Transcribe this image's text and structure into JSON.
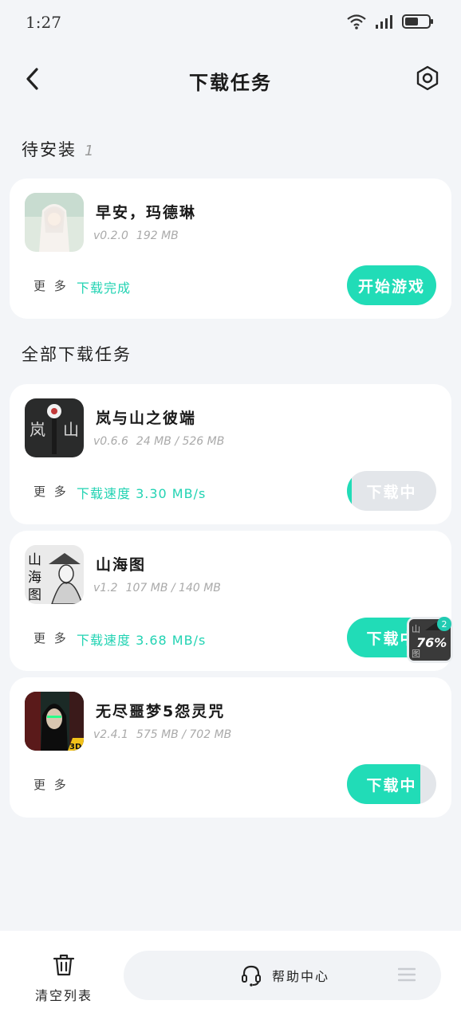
{
  "status_bar": {
    "time": "1:27"
  },
  "header": {
    "title": "下载任务"
  },
  "pending_section": {
    "title": "待安装",
    "count": "1"
  },
  "all_section": {
    "title": "全部下载任务"
  },
  "pending_items": [
    {
      "name": "早安，玛德琳",
      "version": "v0.2.0",
      "size": "192 MB",
      "more": "更 多",
      "status": "下载完成",
      "action": "开始游戏"
    }
  ],
  "download_items": [
    {
      "name": "岚与山之彼端",
      "version": "v0.6.6",
      "size": "24 MB / 526 MB",
      "more": "更 多",
      "status": "下载速度 3.30 MB/s",
      "action": "下载中",
      "progress": 0.05
    },
    {
      "name": "山海图",
      "version": "v1.2",
      "size": "107 MB / 140 MB",
      "more": "更 多",
      "status": "下载速度 3.68 MB/s",
      "action": "下载中",
      "progress": 0.76
    },
    {
      "name": "无尽噩梦5怨灵咒",
      "version": "v2.4.1",
      "size": "575 MB / 702 MB",
      "more": "更 多",
      "status": "",
      "action": "下载中",
      "progress": 0.82
    }
  ],
  "float_widget": {
    "badge": "2",
    "percent": "76%"
  },
  "bottom_bar": {
    "clear_label": "清空列表",
    "help_label": "帮助中心"
  },
  "colors": {
    "accent": "#21dcb7",
    "progress_track": "#e3e6ea",
    "background": "#f3f5f8"
  },
  "icons": [
    "back-arrow-icon",
    "settings-hexagon-icon",
    "wifi-icon",
    "signal-icon",
    "battery-icon",
    "trash-icon",
    "headset-icon",
    "menu-icon"
  ]
}
